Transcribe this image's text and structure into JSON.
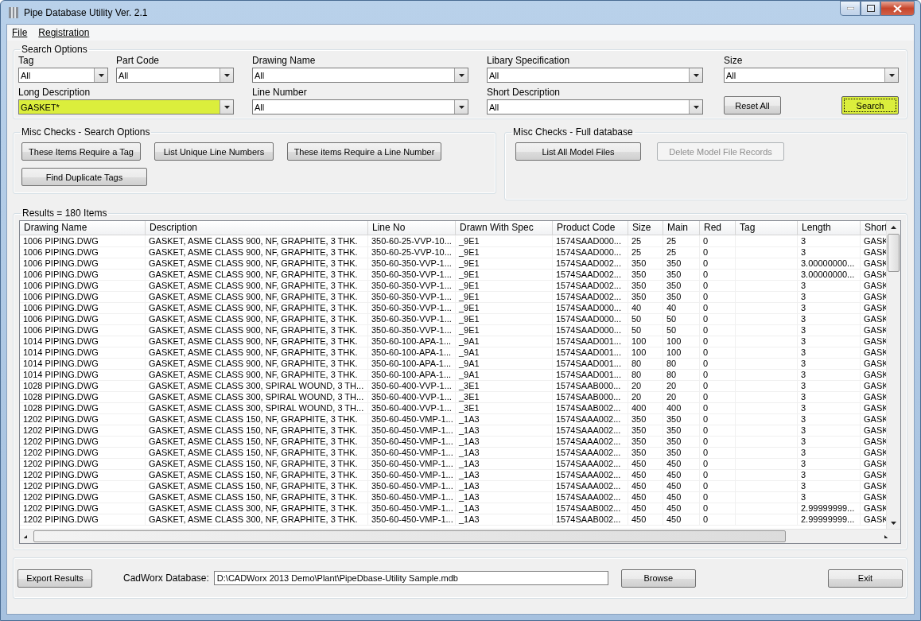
{
  "window": {
    "title": "Pipe Database Utility Ver. 2.1"
  },
  "menu": [
    "File",
    "Registration"
  ],
  "search_options": {
    "legend": "Search Options",
    "fields": [
      {
        "label": "Tag",
        "value": "All",
        "highlighted": false
      },
      {
        "label": "Part Code",
        "value": "All",
        "highlighted": false
      },
      {
        "label": "Drawing Name",
        "value": "All",
        "highlighted": false
      },
      {
        "label": "Libary Specification",
        "value": "All",
        "highlighted": false
      },
      {
        "label": "Size",
        "value": "All",
        "highlighted": false
      },
      {
        "label": "Long Description",
        "value": "GASKET*",
        "highlighted": true
      },
      {
        "label": "Line Number",
        "value": "All",
        "highlighted": false
      },
      {
        "label": "Short Description",
        "value": "All",
        "highlighted": false
      }
    ],
    "buttons": [
      {
        "label": "Reset All",
        "highlighted": false
      },
      {
        "label": "Search",
        "highlighted": true
      }
    ]
  },
  "misc_search": {
    "legend": "Misc Checks - Search Options",
    "buttons": [
      {
        "label": "These Items Require a Tag",
        "disabled": false
      },
      {
        "label": "List Unique Line Numbers",
        "disabled": false
      },
      {
        "label": "These items Require a Line Number",
        "disabled": false
      },
      {
        "label": "Find Duplicate Tags",
        "disabled": false
      }
    ]
  },
  "misc_full": {
    "legend": "Misc Checks - Full database",
    "buttons": [
      {
        "label": "List All Model Files",
        "disabled": false
      },
      {
        "label": "Delete Model File Records",
        "disabled": true
      }
    ]
  },
  "results": {
    "legend": "Results = 180 Items",
    "columns": [
      "Drawing Name",
      "Description",
      "Line No",
      "Drawn With Spec",
      "Product Code",
      "Size",
      "Main",
      "Red",
      "Tag",
      "Length",
      "Short"
    ],
    "rows": [
      [
        "1006 PIPING.DWG",
        "GASKET, ASME CLASS 900, NF, GRAPHITE, 3 THK.",
        "350-60-25-VVP-10...",
        "_9E1",
        "1574SAAD000...",
        "25",
        "25",
        "0",
        null,
        "3",
        "GASK"
      ],
      [
        "1006 PIPING.DWG",
        "GASKET, ASME CLASS 900, NF, GRAPHITE, 3 THK.",
        "350-60-25-VVP-10...",
        "_9E1",
        "1574SAAD000...",
        "25",
        "25",
        "0",
        null,
        "3",
        "GASK"
      ],
      [
        "1006 PIPING.DWG",
        "GASKET, ASME CLASS 900, NF, GRAPHITE, 3 THK.",
        "350-60-350-VVP-1...",
        "_9E1",
        "1574SAAD002...",
        "350",
        "350",
        "0",
        null,
        "3.00000000...",
        "GASK"
      ],
      [
        "1006 PIPING.DWG",
        "GASKET, ASME CLASS 900, NF, GRAPHITE, 3 THK.",
        "350-60-350-VVP-1...",
        "_9E1",
        "1574SAAD002...",
        "350",
        "350",
        "0",
        null,
        "3.00000000...",
        "GASK"
      ],
      [
        "1006 PIPING.DWG",
        "GASKET, ASME CLASS 900, NF, GRAPHITE, 3 THK.",
        "350-60-350-VVP-1...",
        "_9E1",
        "1574SAAD002...",
        "350",
        "350",
        "0",
        null,
        "3",
        "GASK"
      ],
      [
        "1006 PIPING.DWG",
        "GASKET, ASME CLASS 900, NF, GRAPHITE, 3 THK.",
        "350-60-350-VVP-1...",
        "_9E1",
        "1574SAAD002...",
        "350",
        "350",
        "0",
        null,
        "3",
        "GASK"
      ],
      [
        "1006 PIPING.DWG",
        "GASKET, ASME CLASS 900, NF, GRAPHITE, 3 THK.",
        "350-60-350-VVP-1...",
        "_9E1",
        "1574SAAD000...",
        "40",
        "40",
        "0",
        null,
        "3",
        "GASK"
      ],
      [
        "1006 PIPING.DWG",
        "GASKET, ASME CLASS 900, NF, GRAPHITE, 3 THK.",
        "350-60-350-VVP-1...",
        "_9E1",
        "1574SAAD000...",
        "50",
        "50",
        "0",
        null,
        "3",
        "GASK"
      ],
      [
        "1006 PIPING.DWG",
        "GASKET, ASME CLASS 900, NF, GRAPHITE, 3 THK.",
        "350-60-350-VVP-1...",
        "_9E1",
        "1574SAAD000...",
        "50",
        "50",
        "0",
        null,
        "3",
        "GASK"
      ],
      [
        "1014 PIPING.DWG",
        "GASKET, ASME CLASS 900, NF, GRAPHITE, 3 THK.",
        "350-60-100-APA-1...",
        "_9A1",
        "1574SAAD001...",
        "100",
        "100",
        "0",
        null,
        "3",
        "GASK"
      ],
      [
        "1014 PIPING.DWG",
        "GASKET, ASME CLASS 900, NF, GRAPHITE, 3 THK.",
        "350-60-100-APA-1...",
        "_9A1",
        "1574SAAD001...",
        "100",
        "100",
        "0",
        null,
        "3",
        "GASK"
      ],
      [
        "1014 PIPING.DWG",
        "GASKET, ASME CLASS 900, NF, GRAPHITE, 3 THK.",
        "350-60-100-APA-1...",
        "_9A1",
        "1574SAAD001...",
        "80",
        "80",
        "0",
        null,
        "3",
        "GASK"
      ],
      [
        "1014 PIPING.DWG",
        "GASKET, ASME CLASS 900, NF, GRAPHITE, 3 THK.",
        "350-60-100-APA-1...",
        "_9A1",
        "1574SAAD001...",
        "80",
        "80",
        "0",
        null,
        "3",
        "GASK"
      ],
      [
        "1028 PIPING.DWG",
        "GASKET, ASME CLASS 300, SPIRAL WOUND, 3 TH...",
        "350-60-400-VVP-1...",
        "_3E1",
        "1574SAAB000...",
        "20",
        "20",
        "0",
        null,
        "3",
        "GASK"
      ],
      [
        "1028 PIPING.DWG",
        "GASKET, ASME CLASS 300, SPIRAL WOUND, 3 TH...",
        "350-60-400-VVP-1...",
        "_3E1",
        "1574SAAB000...",
        "20",
        "20",
        "0",
        null,
        "3",
        "GASK"
      ],
      [
        "1028 PIPING.DWG",
        "GASKET, ASME CLASS 300, SPIRAL WOUND, 3 TH...",
        "350-60-400-VVP-1...",
        "_3E1",
        "1574SAAB002...",
        "400",
        "400",
        "0",
        null,
        "3",
        "GASK"
      ],
      [
        "1202 PIPING.DWG",
        "GASKET, ASME CLASS 150, NF, GRAPHITE, 3 THK.",
        "350-60-450-VMP-1...",
        "_1A3",
        "1574SAAA002...",
        "350",
        "350",
        "0",
        null,
        "3",
        "GASK"
      ],
      [
        "1202 PIPING.DWG",
        "GASKET, ASME CLASS 150, NF, GRAPHITE, 3 THK.",
        "350-60-450-VMP-1...",
        "_1A3",
        "1574SAAA002...",
        "350",
        "350",
        "0",
        null,
        "3",
        "GASK"
      ],
      [
        "1202 PIPING.DWG",
        "GASKET, ASME CLASS 150, NF, GRAPHITE, 3 THK.",
        "350-60-450-VMP-1...",
        "_1A3",
        "1574SAAA002...",
        "350",
        "350",
        "0",
        null,
        "3",
        "GASK"
      ],
      [
        "1202 PIPING.DWG",
        "GASKET, ASME CLASS 150, NF, GRAPHITE, 3 THK.",
        "350-60-450-VMP-1...",
        "_1A3",
        "1574SAAA002...",
        "350",
        "350",
        "0",
        null,
        "3",
        "GASK"
      ],
      [
        "1202 PIPING.DWG",
        "GASKET, ASME CLASS 150, NF, GRAPHITE, 3 THK.",
        "350-60-450-VMP-1...",
        "_1A3",
        "1574SAAA002...",
        "450",
        "450",
        "0",
        null,
        "3",
        "GASK"
      ],
      [
        "1202 PIPING.DWG",
        "GASKET, ASME CLASS 150, NF, GRAPHITE, 3 THK.",
        "350-60-450-VMP-1...",
        "_1A3",
        "1574SAAA002...",
        "450",
        "450",
        "0",
        null,
        "3",
        "GASK"
      ],
      [
        "1202 PIPING.DWG",
        "GASKET, ASME CLASS 150, NF, GRAPHITE, 3 THK.",
        "350-60-450-VMP-1...",
        "_1A3",
        "1574SAAA002...",
        "450",
        "450",
        "0",
        null,
        "3",
        "GASK"
      ],
      [
        "1202 PIPING.DWG",
        "GASKET, ASME CLASS 150, NF, GRAPHITE, 3 THK.",
        "350-60-450-VMP-1...",
        "_1A3",
        "1574SAAA002...",
        "450",
        "450",
        "0",
        null,
        "3",
        "GASK"
      ],
      [
        "1202 PIPING.DWG",
        "GASKET, ASME CLASS 300, NF, GRAPHITE, 3 THK.",
        "350-60-450-VMP-1...",
        "_1A3",
        "1574SAAB002...",
        "450",
        "450",
        "0",
        null,
        "2.99999999...",
        "GASK"
      ],
      [
        "1202 PIPING.DWG",
        "GASKET, ASME CLASS 300, NF, GRAPHITE, 3 THK.",
        "350-60-450-VMP-1...",
        "_1A3",
        "1574SAAB002...",
        "450",
        "450",
        "0",
        null,
        "2.99999999...",
        "GASK"
      ]
    ]
  },
  "bottom": {
    "export_button": "Export Results",
    "database_label": "CadWorx Database:",
    "database_path": "D:\\CADWorx 2013 Demo\\Plant\\PipeDbase-Utility Sample.mdb",
    "browse_button": "Browse",
    "exit_button": "Exit"
  }
}
